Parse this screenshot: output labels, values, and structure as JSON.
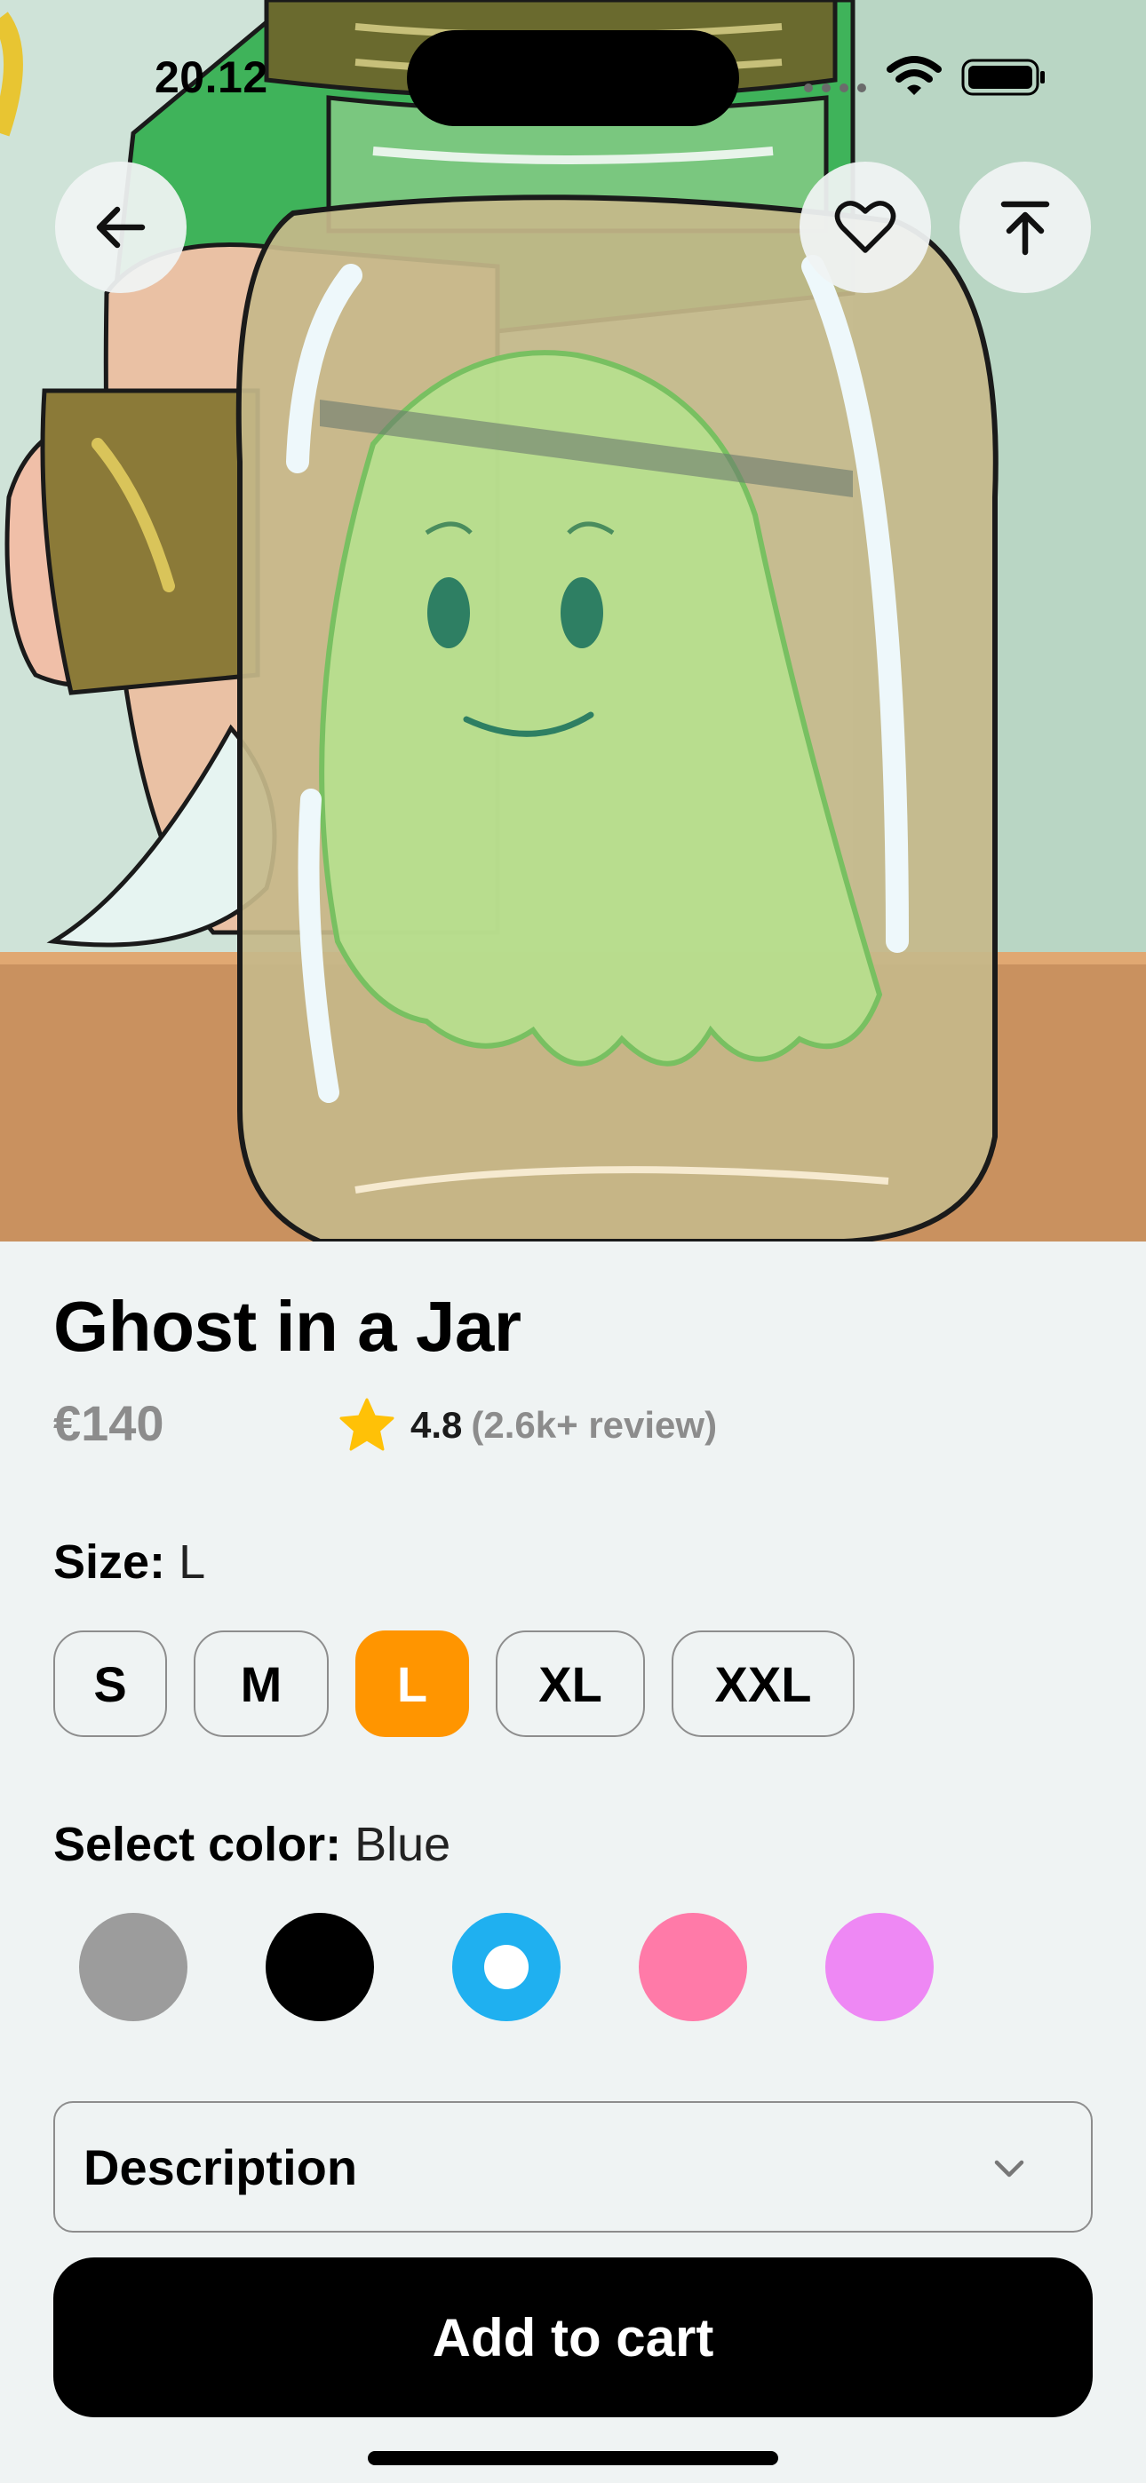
{
  "status_bar": {
    "time": "20.12",
    "icons": [
      "signal-dots-icon",
      "wifi-icon",
      "battery-icon"
    ]
  },
  "hero": {
    "image_description_icon": "ghost-in-jar-illustration",
    "buttons": {
      "back_icon": "arrow-left-icon",
      "favorite_icon": "heart-icon",
      "scroll_top_icon": "arrow-up-to-top-icon"
    }
  },
  "product": {
    "title": "Ghost in a Jar",
    "price": "€140",
    "rating": {
      "score": "4.8",
      "reviews": "(2.6k+ review)",
      "star_color": "#ffc107"
    }
  },
  "size": {
    "label": "Size:",
    "selected": "L",
    "options": [
      "S",
      "M",
      "L",
      "XL",
      "XXL"
    ],
    "active_color": "#ff9500"
  },
  "color": {
    "label": "Select color:",
    "selected": "Blue",
    "options": [
      {
        "name": "Gray",
        "hex": "#9c9c9c"
      },
      {
        "name": "Black",
        "hex": "#000000"
      },
      {
        "name": "Blue",
        "hex": "#1fb0f0"
      },
      {
        "name": "Pink",
        "hex": "#ff7aa8"
      },
      {
        "name": "Violet",
        "hex": "#ee88f4"
      }
    ]
  },
  "description": {
    "label": "Description",
    "expanded": false
  },
  "cart": {
    "label": "Add to cart"
  }
}
